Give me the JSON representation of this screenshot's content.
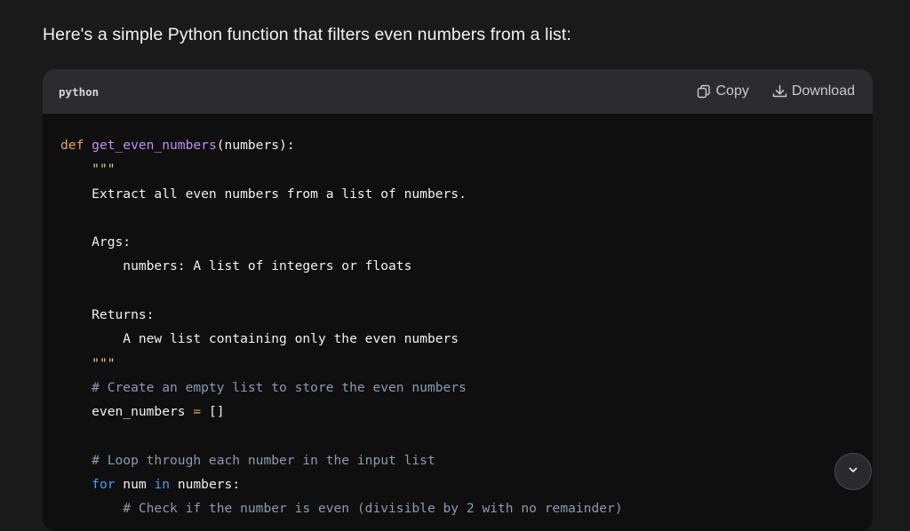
{
  "message": {
    "intro": "Here's a simple Python function that filters even numbers from a list:"
  },
  "code_block": {
    "language": "python",
    "copy_label": "Copy",
    "download_label": "Download",
    "lines": [
      {
        "tokens": [
          {
            "t": "def ",
            "c": "kw"
          },
          {
            "t": "get_even_numbers",
            "c": "fn"
          },
          {
            "t": "(numbers):",
            "c": ""
          }
        ]
      },
      {
        "tokens": [
          {
            "t": "    ",
            "c": ""
          },
          {
            "t": "\"\"\"",
            "c": "ds"
          }
        ]
      },
      {
        "tokens": [
          {
            "t": "    Extract all even numbers from a list of numbers.",
            "c": ""
          }
        ]
      },
      {
        "tokens": []
      },
      {
        "tokens": [
          {
            "t": "    Args:",
            "c": ""
          }
        ]
      },
      {
        "tokens": [
          {
            "t": "        numbers: A list of integers or floats",
            "c": ""
          }
        ]
      },
      {
        "tokens": []
      },
      {
        "tokens": [
          {
            "t": "    Returns:",
            "c": ""
          }
        ]
      },
      {
        "tokens": [
          {
            "t": "        A new list containing only the even numbers",
            "c": ""
          }
        ]
      },
      {
        "tokens": [
          {
            "t": "    ",
            "c": ""
          },
          {
            "t": "\"\"\"",
            "c": "ds"
          }
        ]
      },
      {
        "tokens": [
          {
            "t": "    # Create an empty list to store the even numbers",
            "c": "cm"
          }
        ]
      },
      {
        "tokens": [
          {
            "t": "    even_numbers ",
            "c": ""
          },
          {
            "t": "=",
            "c": "op"
          },
          {
            "t": " []",
            "c": ""
          }
        ]
      },
      {
        "tokens": []
      },
      {
        "tokens": [
          {
            "t": "    # Loop through each number in the input list",
            "c": "cm"
          }
        ]
      },
      {
        "tokens": [
          {
            "t": "    ",
            "c": ""
          },
          {
            "t": "for",
            "c": "kwb"
          },
          {
            "t": " num ",
            "c": ""
          },
          {
            "t": "in",
            "c": "kwb"
          },
          {
            "t": " numbers:",
            "c": ""
          }
        ]
      },
      {
        "tokens": [
          {
            "t": "        # Check if the number is even (divisible by 2 with no remainder)",
            "c": "cm"
          }
        ]
      }
    ]
  },
  "icons": {
    "copy": "copy-icon",
    "download": "download-icon",
    "scroll_down": "chevron-down-icon"
  },
  "colors": {
    "background": "#1a1a1a",
    "code_header": "#2c2c2f",
    "code_body": "#0f0f10",
    "keyword": "#e8a55a",
    "function_name": "#c58ef0",
    "comment": "#8b9bb0",
    "control_keyword": "#4a9ee8"
  }
}
